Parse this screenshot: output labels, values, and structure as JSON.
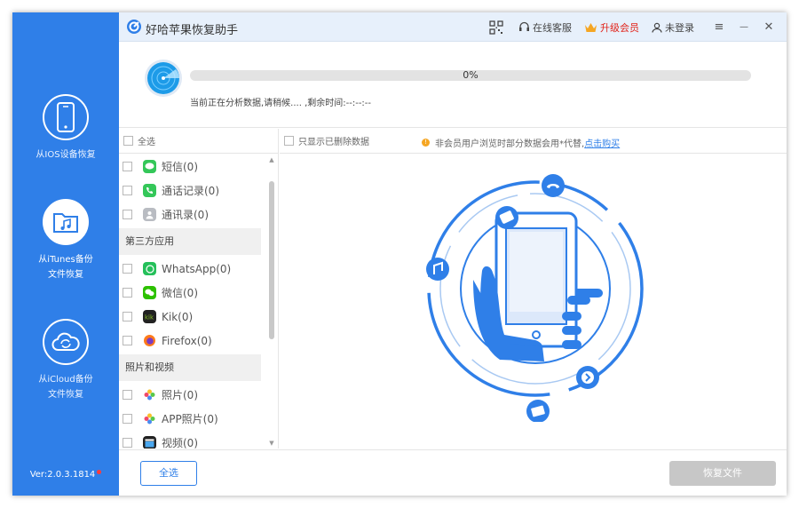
{
  "app": {
    "title": "好哈苹果恢复助手"
  },
  "toolbar": {
    "service_label": "在线客服",
    "vip_label": "升级会员",
    "login_label": "未登录",
    "menu_glyph": "≡",
    "minimize_glyph": "—",
    "close_glyph": "✕"
  },
  "sidebar": {
    "items": [
      {
        "label_line1": "从IOS设备恢复",
        "label_line2": ""
      },
      {
        "label_line1": "从iTunes备份",
        "label_line2": "文件恢复"
      },
      {
        "label_line1": "从iCloud备份",
        "label_line2": "文件恢复"
      }
    ],
    "version": "Ver:2.0.3.1814"
  },
  "progress": {
    "value_text": "0%",
    "value": 0,
    "status_text": "当前正在分析数据,请稍候.... ,剩余时间:--:--:--"
  },
  "list": {
    "select_all_label": "全选",
    "groups": [
      {
        "title": "",
        "items": [
          "短信(0)",
          "通话记录(0)",
          "通讯录(0)"
        ]
      },
      {
        "title": "第三方应用",
        "items": [
          "WhatsApp(0)",
          "微信(0)",
          "Kik(0)",
          "Firefox(0)"
        ]
      },
      {
        "title": "照片和视频",
        "items": [
          "照片(0)",
          "APP照片(0)",
          "视频(0)"
        ]
      }
    ]
  },
  "content": {
    "only_deleted_label": "只显示已删除数据",
    "notice_text": "非会员用户浏览时部分数据会用*代替,",
    "notice_link": "点击购买"
  },
  "footer": {
    "select_all_label": "全选",
    "recover_label": "恢复文件"
  },
  "colors": {
    "accent": "#2f7fe8",
    "vip": "#e2231a",
    "warning": "#f5a623",
    "disabled": "#c7c7c7"
  }
}
